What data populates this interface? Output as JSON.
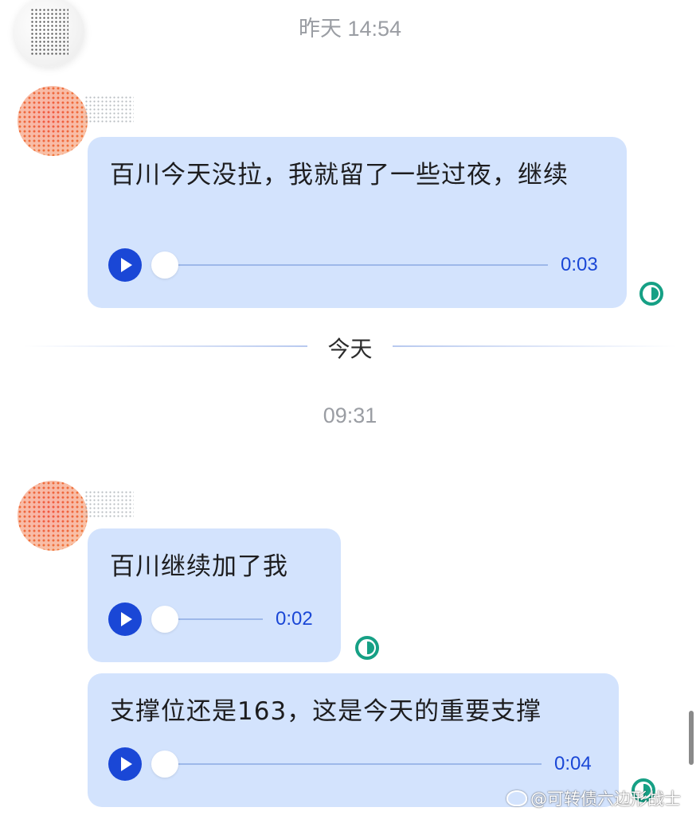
{
  "timestamps": {
    "yesterday": "昨天 14:54",
    "today_time": "09:31"
  },
  "divider": {
    "label": "今天"
  },
  "messages": [
    {
      "text": "百川今天没拉，我就留了一些过夜，继续",
      "duration": "0:03",
      "progress": 0
    },
    {
      "text": "百川继续加了我",
      "duration": "0:02",
      "progress": 0
    },
    {
      "text": "支撑位还是163，这是今天的重要支撑",
      "duration": "0:04",
      "progress": 0
    }
  ],
  "watermark": {
    "text": "@可转债六边形战士",
    "icon": "weibo-icon"
  },
  "colors": {
    "bubble": "#d3e3fd",
    "accent": "#1a47d6",
    "status": "#16a085",
    "timestamp": "#9a9da3"
  }
}
